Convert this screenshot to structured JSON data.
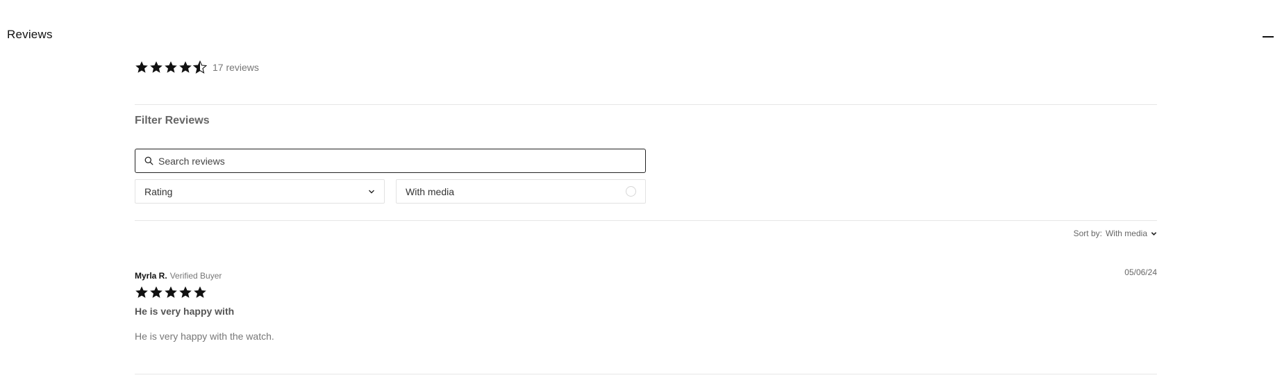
{
  "section": {
    "title": "Reviews",
    "collapse_icon": "minus-icon"
  },
  "summary": {
    "rating": 4.5,
    "max_rating": 5,
    "count_label": "17 reviews"
  },
  "filters": {
    "title": "Filter Reviews",
    "search_placeholder": "Search reviews",
    "rating_label": "Rating",
    "media_label": "With media",
    "media_checked": false
  },
  "sort": {
    "label": "Sort by:",
    "value": "With media"
  },
  "reviews": [
    {
      "author": "Myrla R.",
      "badge": "Verified Buyer",
      "date": "05/06/24",
      "rating": 5,
      "headline": "He is very happy with",
      "body": "He is very happy with the watch."
    }
  ],
  "colors": {
    "star": "#111111",
    "divider": "#e6e6e6"
  }
}
